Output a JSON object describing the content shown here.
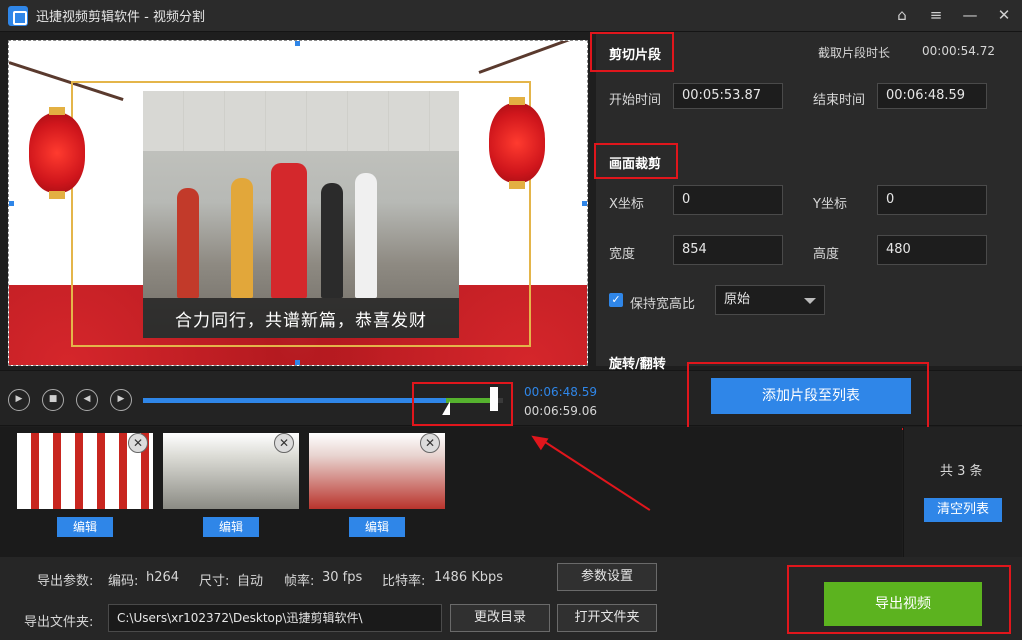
{
  "window": {
    "title": "迅捷视频剪辑软件 - 视频分割",
    "controls": [
      "⌂",
      "≡",
      "—",
      "✕"
    ]
  },
  "preview": {
    "subtitle": "合力同行，共谱新篇，恭喜发财"
  },
  "cut": {
    "title": "剪切片段",
    "duration_label": "截取片段时长",
    "duration_value": "00:00:54.72",
    "start_label": "开始时间",
    "start_value": "00:05:53.87",
    "end_label": "结束时间",
    "end_value": "00:06:48.59"
  },
  "crop": {
    "title": "画面裁剪",
    "x_label": "X坐标",
    "x_value": "0",
    "y_label": "Y坐标",
    "y_value": "0",
    "width_label": "宽度",
    "width_value": "854",
    "height_label": "高度",
    "height_value": "480",
    "keep_ratio_label": "保持宽高比",
    "keep_ratio_checked": true,
    "ratio_option": "原始"
  },
  "rotate": {
    "title": "旋转/翻转"
  },
  "player": {
    "current_time": "00:06:48.59",
    "total_time": "00:06:59.06",
    "add_button": "添加片段至列表",
    "progress_fraction": 0.974,
    "selection_start_fraction": 0.842,
    "selection_end_fraction": 0.974
  },
  "clips": {
    "items": [
      {
        "edit_label": "编辑"
      },
      {
        "edit_label": "编辑"
      },
      {
        "edit_label": "编辑"
      }
    ],
    "count_text": "共 3 条",
    "clear_button": "清空列表"
  },
  "export": {
    "params_label": "导出参数:",
    "codec_label": "编码:",
    "codec_value": "h264",
    "size_label": "尺寸:",
    "size_value": "自动",
    "fps_label": "帧率:",
    "fps_value": "30 fps",
    "bitrate_label": "比特率:",
    "bitrate_value": "1486 Kbps",
    "settings_button": "参数设置",
    "folder_label": "导出文件夹:",
    "folder_path": "C:\\Users\\xr102372\\Desktop\\迅捷剪辑软件\\",
    "change_dir_button": "更改目录",
    "open_folder_button": "打开文件夹",
    "export_button": "导出视频"
  },
  "colors": {
    "accent": "#2f86e8",
    "export_green": "#5cb31f",
    "annotation_red": "#e0161c"
  }
}
